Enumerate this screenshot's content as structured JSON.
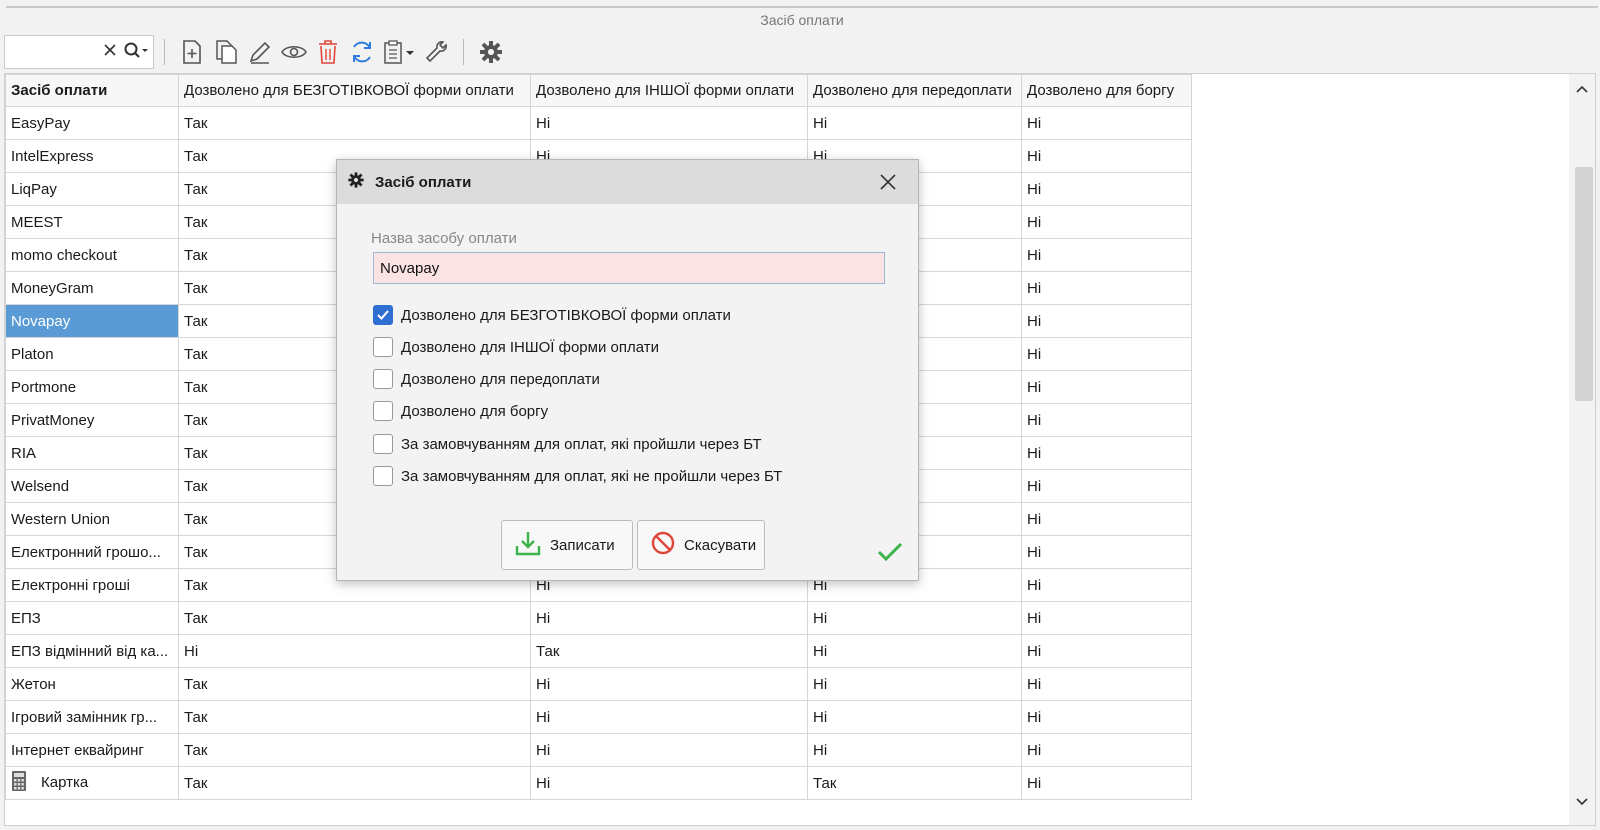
{
  "window": {
    "title": "Засіб оплати"
  },
  "toolbar": {
    "search_value": "",
    "icons": [
      "clear-icon",
      "search-icon",
      "add-document-icon",
      "copy-icon",
      "edit-pencil-icon",
      "view-eye-icon",
      "delete-trash-icon",
      "refresh-icon",
      "clipboard-icon",
      "tools-wrench-icon",
      "settings-gear-icon"
    ]
  },
  "table": {
    "headers": [
      "Засіб оплати",
      "Дозволено для БЕЗГОТІВКОВОЇ форми оплати",
      "Дозволено для ІНШОЇ форми оплати",
      "Дозволено для передоплати",
      "Дозволено для боргу"
    ],
    "rows": [
      [
        "EasyPay",
        "Так",
        "Ні",
        "Ні",
        "Ні"
      ],
      [
        "IntelExpress",
        "Так",
        "Ні",
        "Ні",
        "Ні"
      ],
      [
        "LiqPay",
        "Так",
        "",
        "",
        "Ні"
      ],
      [
        "MEEST",
        "Так",
        "",
        "",
        "Ні"
      ],
      [
        "momo checkout",
        "Так",
        "",
        "",
        "Ні"
      ],
      [
        "MoneyGram",
        "Так",
        "",
        "",
        "Ні"
      ],
      [
        "Novapay",
        "Так",
        "",
        "",
        "Ні"
      ],
      [
        "Platon",
        "Так",
        "",
        "",
        "Ні"
      ],
      [
        "Portmone",
        "Так",
        "",
        "",
        "Ні"
      ],
      [
        "PrivatMoney",
        "Так",
        "",
        "",
        "Ні"
      ],
      [
        "RIA",
        "Так",
        "",
        "",
        "Ні"
      ],
      [
        "Welsend",
        "Так",
        "",
        "",
        "Ні"
      ],
      [
        "Western Union",
        "Так",
        "",
        "",
        "Ні"
      ],
      [
        "Електронний грошо...",
        "Так",
        "",
        "",
        "Ні"
      ],
      [
        "Електронні гроші",
        "Так",
        "Ні",
        "Ні",
        "Ні"
      ],
      [
        "ЕПЗ",
        "Так",
        "Ні",
        "Ні",
        "Ні"
      ],
      [
        "ЕПЗ відмінний від ка...",
        "Ні",
        "Так",
        "Ні",
        "Ні"
      ],
      [
        "Жетон",
        "Так",
        "Ні",
        "Ні",
        "Ні"
      ],
      [
        "Ігровий замінник гр...",
        "Так",
        "Ні",
        "Ні",
        "Ні"
      ],
      [
        "Інтернет еквайринг",
        "Так",
        "Ні",
        "Ні",
        "Ні"
      ],
      [
        "Картка",
        "Так",
        "Ні",
        "Так",
        "Ні"
      ]
    ],
    "selected_row": 6
  },
  "dialog": {
    "title": "Засіб оплати",
    "name_label": "Назва засобу оплати",
    "name_value": "Novapay",
    "checkboxes": [
      {
        "label": "Дозволено для БЕЗГОТІВКОВОЇ форми оплати",
        "checked": true
      },
      {
        "label": "Дозволено для ІНШОЇ форми оплати",
        "checked": false
      },
      {
        "label": "Дозволено для передоплати",
        "checked": false
      },
      {
        "label": "Дозволено для боргу",
        "checked": false
      },
      {
        "label": "За замовчуванням для оплат, які пройшли через БТ",
        "checked": false
      },
      {
        "label": "За замовчуванням для оплат, які не пройшли через БТ",
        "checked": false
      }
    ],
    "save_label": "Записати",
    "cancel_label": "Скасувати"
  },
  "colors": {
    "selection": "#5a9bd5",
    "accent_blue": "#2f6fd1",
    "delete_red": "#e0453a",
    "ok_green": "#3db34a"
  }
}
